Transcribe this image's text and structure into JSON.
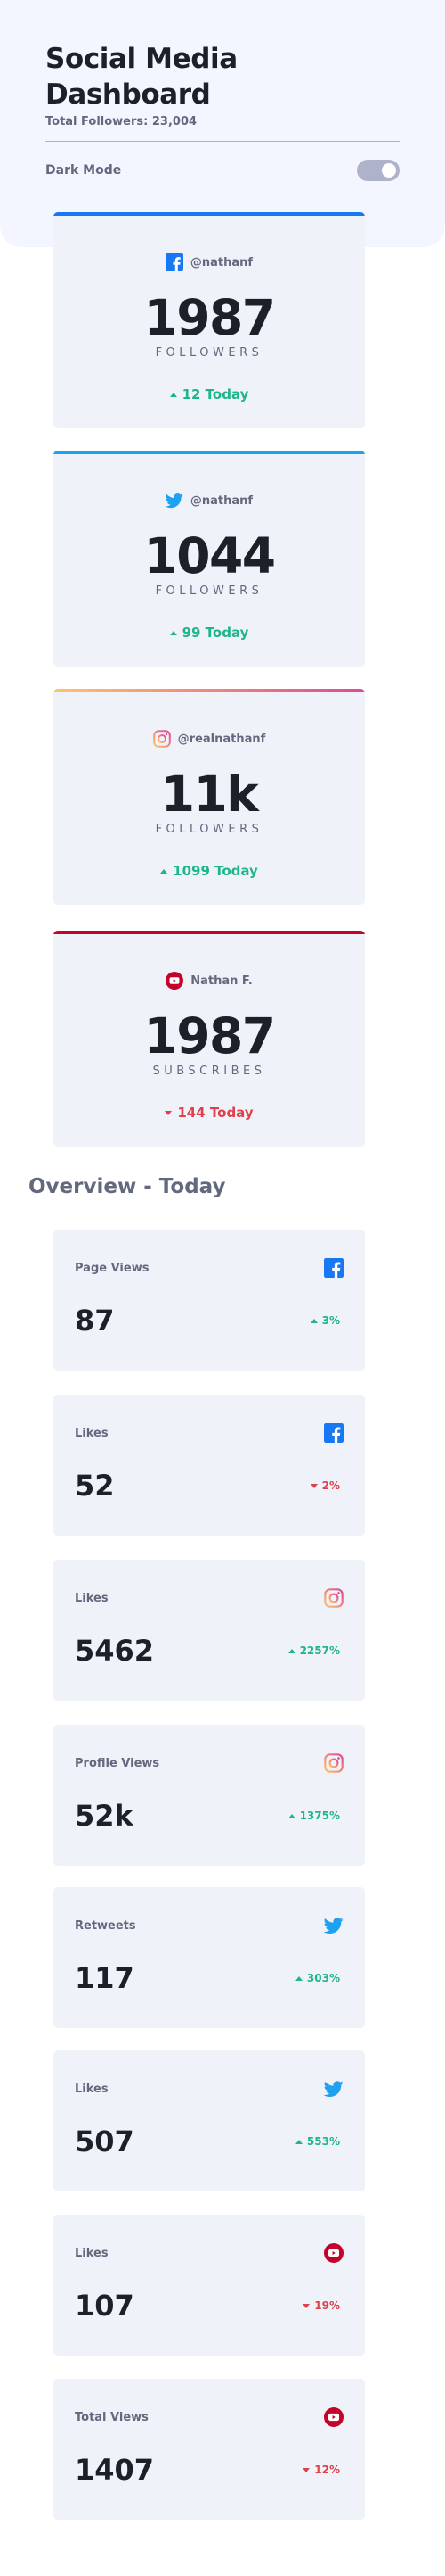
{
  "header": {
    "title": "Social Media Dashboard",
    "total_followers": "Total Followers: 23,004",
    "dark_mode_label": "Dark Mode"
  },
  "colors": {
    "facebook": "#1877f2",
    "twitter": "#1da1f2",
    "instagram_gradient": [
      "#fdc468",
      "#df4996"
    ],
    "youtube": "#c4032b",
    "up": "#1eb589",
    "down": "#dc414c"
  },
  "followers": [
    {
      "platform": "facebook",
      "icon": "facebook-icon",
      "handle": "@nathanf",
      "count": "1987",
      "unit": "FOLLOWERS",
      "today": "12 Today",
      "trend": "up"
    },
    {
      "platform": "twitter",
      "icon": "twitter-icon",
      "handle": "@nathanf",
      "count": "1044",
      "unit": "FOLLOWERS",
      "today": "99 Today",
      "trend": "up"
    },
    {
      "platform": "instagram",
      "icon": "instagram-icon",
      "handle": "@realnathanf",
      "count": "11k",
      "unit": "FOLLOWERS",
      "today": "1099 Today",
      "trend": "up"
    },
    {
      "platform": "youtube",
      "icon": "youtube-icon",
      "handle": "Nathan F.",
      "count": "1987",
      "unit": "SUBSCRIBES",
      "today": "144 Today",
      "trend": "down"
    }
  ],
  "overview": {
    "title": "Overview - Today",
    "cards": [
      {
        "label": "Page Views",
        "icon": "facebook-icon",
        "value": "87",
        "pct": "3%",
        "trend": "up"
      },
      {
        "label": "Likes",
        "icon": "facebook-icon",
        "value": "52",
        "pct": "2%",
        "trend": "down"
      },
      {
        "label": "Likes",
        "icon": "instagram-icon",
        "value": "5462",
        "pct": "2257%",
        "trend": "up"
      },
      {
        "label": "Profile Views",
        "icon": "instagram-icon",
        "value": "52k",
        "pct": "1375%",
        "trend": "up"
      },
      {
        "label": "Retweets",
        "icon": "twitter-icon",
        "value": "117",
        "pct": "303%",
        "trend": "up"
      },
      {
        "label": "Likes",
        "icon": "twitter-icon",
        "value": "507",
        "pct": "553%",
        "trend": "up"
      },
      {
        "label": "Likes",
        "icon": "youtube-icon",
        "value": "107",
        "pct": "19%",
        "trend": "down"
      },
      {
        "label": "Total Views",
        "icon": "youtube-icon",
        "value": "1407",
        "pct": "12%",
        "trend": "down"
      }
    ]
  }
}
